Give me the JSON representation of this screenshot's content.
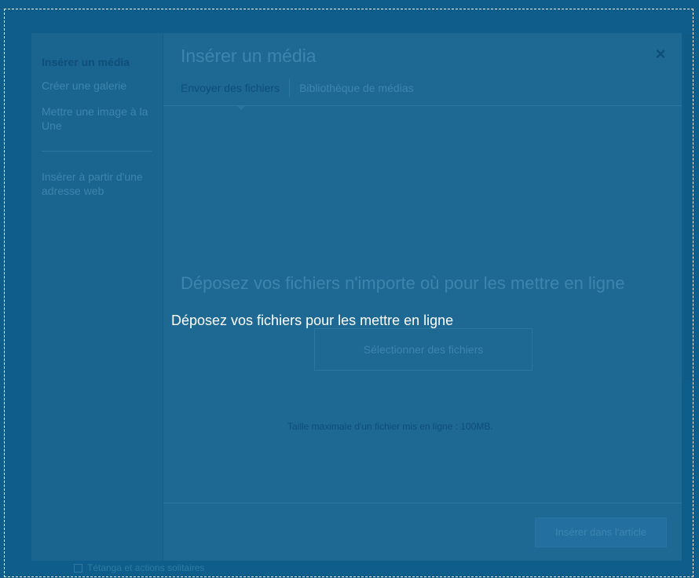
{
  "background_page": {
    "checkbox_label": "Tétanga et actions solitaires"
  },
  "modal": {
    "sidebar": {
      "items": [
        {
          "label": "Insérer un média",
          "active": true
        },
        {
          "label": "Créer une galerie",
          "active": false
        },
        {
          "label": "Mettre une image à la Une",
          "active": false
        },
        {
          "label": "Insérer à partir d'une adresse web",
          "active": false
        }
      ]
    },
    "title": "Insérer un média",
    "close_icon": "×",
    "tabs": [
      {
        "label": "Envoyer des fichiers",
        "active": true
      },
      {
        "label": "Bibliothèque de médias",
        "active": false
      }
    ],
    "uploader": {
      "heading": "Déposez vos fichiers n'importe où pour les mettre en ligne",
      "select_button": "Sélectionner des fichiers",
      "max_size": "Taille maximale d'un fichier mis en ligne : 100MB."
    },
    "toolbar": {
      "insert_button": "Insérer dans l'article"
    }
  },
  "drop_overlay": {
    "message": "Déposez vos fichiers pour les mettre en ligne"
  },
  "colors": {
    "overlay": "#0c5782",
    "text_white": "#ffffff"
  }
}
